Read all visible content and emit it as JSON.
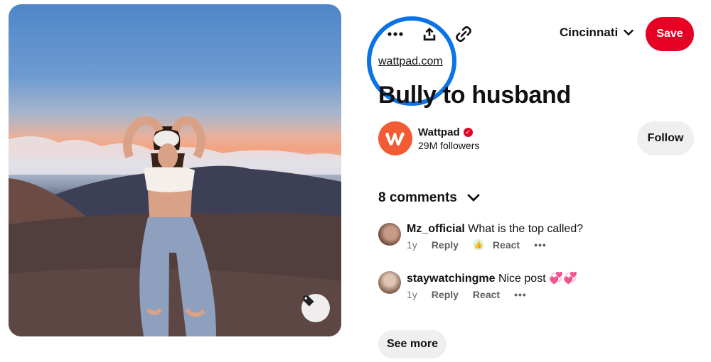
{
  "pin": {
    "image_alt": "",
    "tag_icon": "tag-icon"
  },
  "toolbar": {
    "more_icon": "more-horizontal-icon",
    "share_icon": "share-upload-icon",
    "link_icon": "link-icon",
    "board_name": "Cincinnati",
    "save_label": "Save"
  },
  "source": {
    "link_text": "wattpad.com"
  },
  "title": "Bully to husband",
  "creator": {
    "name": "Wattpad",
    "followers": "29M followers",
    "follow_label": "Follow",
    "verified_icon": "verified-check-icon"
  },
  "comments": {
    "header": "8 comments",
    "items": [
      {
        "user": "Mz_official",
        "text": "What is the top called?",
        "age": "1y",
        "reply": "Reply",
        "react": "React",
        "has_reaction": true
      },
      {
        "user": "staywatchingme",
        "text": "Nice post 💞💞",
        "age": "1y",
        "reply": "Reply",
        "react": "React",
        "has_reaction": false
      }
    ],
    "see_more_label": "See more"
  },
  "colors": {
    "save_red": "#e60023",
    "highlight_blue": "#0a74e6",
    "wattpad_orange": "#f25b34",
    "button_gray": "#efefef"
  }
}
